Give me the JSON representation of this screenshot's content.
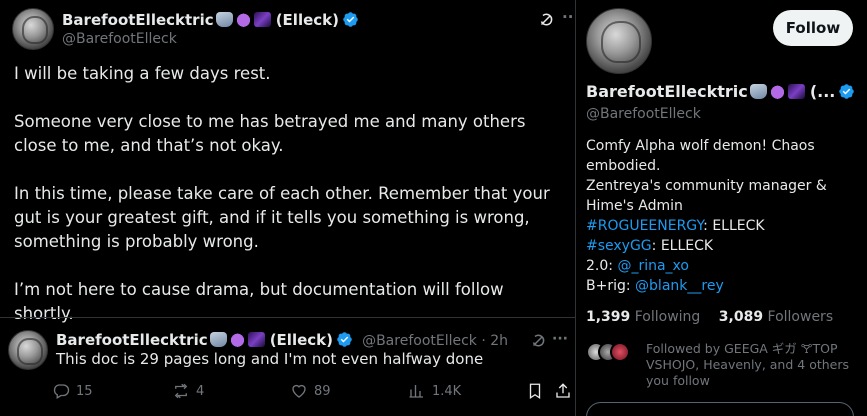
{
  "post": {
    "display_name": "BarefootEllecktric",
    "name_suffix": "(Elleck)",
    "handle": "@BarefootElleck",
    "more_glyph": "··",
    "paragraphs": [
      "I will be taking a few days rest.",
      "Someone very close to me has betrayed me and many others close to me, and that’s not okay.",
      "In this time, please take care of each other. Remember that your gut is your greatest gift, and if it tells you something is wrong, something is probably wrong.",
      "I’m not here to cause drama, but documentation will follow shortly."
    ]
  },
  "reply": {
    "display_name": "BarefootEllecktric",
    "name_suffix": "(Elleck)",
    "handle_time": "@BarefootElleck · 2h",
    "more_glyph": "···",
    "text": "This doc is 29 pages long and I'm not even halfway done",
    "actions": {
      "replies": "15",
      "reposts": "4",
      "likes": "89",
      "views": "1.4K"
    }
  },
  "profile": {
    "follow_label": "Follow",
    "display_name": "BarefootEllecktric",
    "name_suffix": "(...",
    "handle": "@BarefootElleck",
    "bio": {
      "line1": "Comfy Alpha wolf demon! Chaos embodied.",
      "line2": "Zentreya's community manager & Hime's Admin",
      "l3_link": "#ROGUEENERGY",
      "l3_text": ": ELLECK",
      "l4_link": "#sexyGG",
      "l4_text": ": ELLECK",
      "l5_text": "2.0: ",
      "l5_link": "@_rina_xo",
      "l6_text": "B+rig: ",
      "l6_link": "@blank__rey"
    },
    "following_count": "1,399",
    "following_label": "Following",
    "followers_count": "3,089",
    "followers_label": "Followers",
    "followed_by": "Followed by GEEGA ギガ 🝖TOP VSHOJO, Heavenly, and 4 others you follow"
  },
  "colors": {
    "accent": "#1d9bf0",
    "muted": "#71767b",
    "text": "#e7e9ea",
    "background": "#000000"
  },
  "icons": [
    "verified-badge-icon",
    "wolf-emoji-icon",
    "devil-emoji-icon",
    "galaxy-emoji-icon",
    "grok-icon",
    "reply-icon",
    "repost-icon",
    "like-icon",
    "views-icon",
    "bookmark-icon",
    "share-icon"
  ]
}
